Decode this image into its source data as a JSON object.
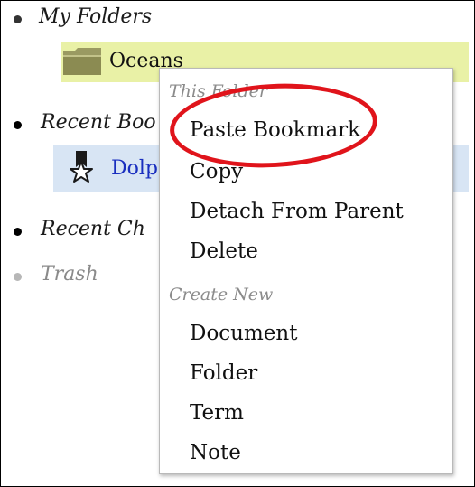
{
  "tree": {
    "my_folders": {
      "label": "My Folders",
      "children": [
        {
          "label": "Oceans",
          "icon": "folder-icon"
        }
      ]
    },
    "recent_bookmarks": {
      "label": "Recent Boo",
      "children": [
        {
          "label": "Dolp",
          "icon": "bookmark-star-icon"
        }
      ]
    },
    "recent_changes": {
      "label": "Recent Ch"
    },
    "trash": {
      "label": "Trash"
    }
  },
  "context_menu": {
    "this_folder_header": "This Folder",
    "items_this_folder": [
      "Paste Bookmark",
      "Copy",
      "Detach From Parent",
      "Delete"
    ],
    "create_new_header": "Create New",
    "items_create_new": [
      "Document",
      "Folder",
      "Term",
      "Note"
    ]
  },
  "colors": {
    "selected_row": "#e9f1a6",
    "bookmark_row": "#d8e5f4",
    "link": "#1a2fbf",
    "annotation": "#e0141b"
  }
}
